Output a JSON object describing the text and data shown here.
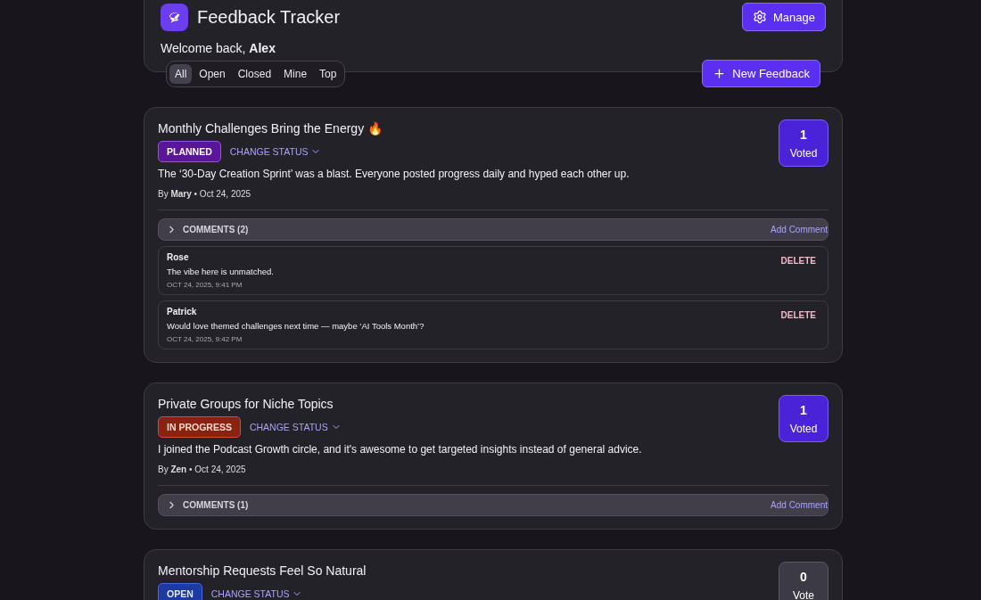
{
  "header": {
    "title": "Feedback Tracker",
    "manage_button": "Manage",
    "welcome": "Welcome back, **Alex**"
  },
  "filters": [
    {
      "label": "All",
      "selected": true
    },
    {
      "label": "Open",
      "selected": false
    },
    {
      "label": "Closed",
      "selected": false
    },
    {
      "label": "Mine",
      "selected": false
    },
    {
      "label": "Top",
      "selected": false
    }
  ],
  "new_button": "New Feedback",
  "posts": [
    {
      "title": "Monthly Challenges Bring the Energy 🔥",
      "status": {
        "kind": "planned",
        "label": "PLANNED"
      },
      "change_status": "CHANGE STATUS",
      "body": "The ‘30-Day Creation Sprint’ was a blast. Everyone posted progress daily and hyped each other up.",
      "meta": "By **Mary** • Oct 24, 2025",
      "votes": "1",
      "vote_label": "Voted",
      "voted": true,
      "comments_label": "COMMENTS (2)",
      "add_comment": "Add Comment",
      "comments": [
        {
          "author": "Rose",
          "text": "The vibe here is unmatched.",
          "time": "OCT 24, 2025, 9:41 PM",
          "delete": "DELETE"
        },
        {
          "author": "Patrick",
          "text": "Would love themed challenges next time — maybe ‘AI Tools Month’?",
          "time": "OCT 24, 2025, 9:42 PM",
          "delete": "DELETE"
        }
      ]
    },
    {
      "title": "Private Groups for Niche Topics",
      "status": {
        "kind": "in_progress",
        "label": "IN PROGRESS"
      },
      "change_status": "CHANGE STATUS",
      "body": "I joined the Podcast Growth circle, and it's awesome to get targeted insights instead of general advice.",
      "meta": "By **Zen** • Oct 24, 2025",
      "votes": "1",
      "vote_label": "Voted",
      "voted": true,
      "comments_label": "COMMENTS (1)",
      "add_comment": "Add Comment"
    },
    {
      "title": "Mentorship Requests Feel So Natural",
      "status": {
        "kind": "open",
        "label": "OPEN"
      },
      "change_status": "CHANGE STATUS",
      "votes": "0",
      "vote_label": "Vote",
      "voted": false
    }
  ]
}
